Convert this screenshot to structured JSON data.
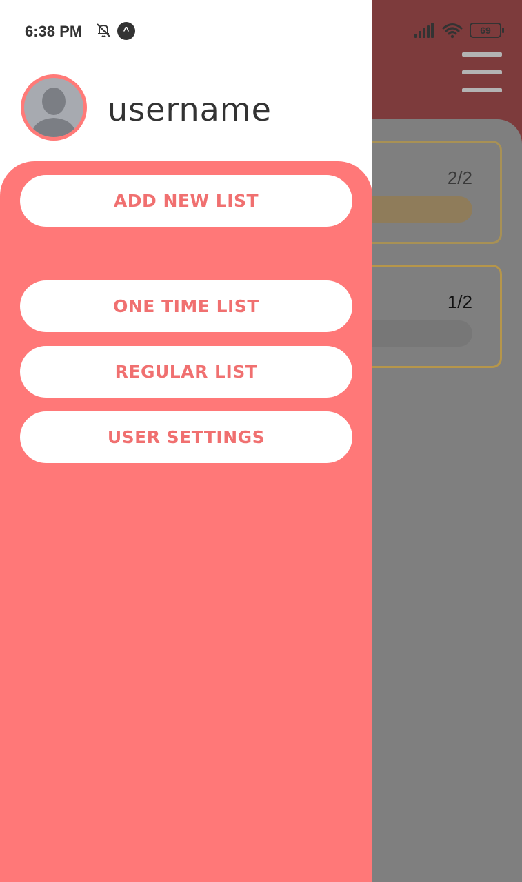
{
  "status_bar": {
    "time": "6:38 PM",
    "battery": "69"
  },
  "background": {
    "cards": [
      {
        "count": "2/2"
      },
      {
        "count": "1/2"
      }
    ]
  },
  "drawer": {
    "username": "username",
    "menu": {
      "add_new_list": "ADD NEW LIST",
      "one_time_list": "ONE TIME LIST",
      "regular_list": "REGULAR LIST",
      "user_settings": "USER SETTINGS"
    }
  },
  "colors": {
    "accent": "#ff7878",
    "button_text": "#f07070",
    "overlay_header": "#7d3b3c"
  }
}
